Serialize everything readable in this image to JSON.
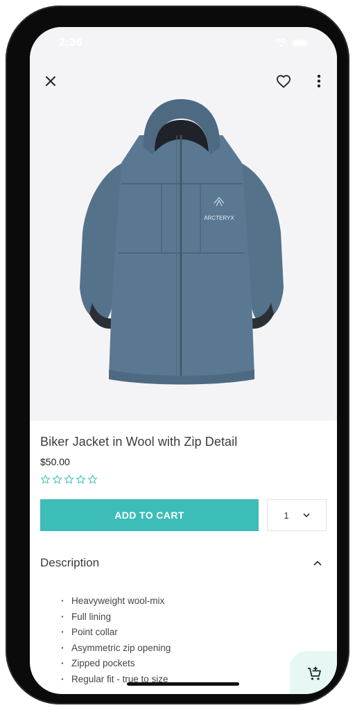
{
  "status_bar": {
    "time": "2:36"
  },
  "icons": {
    "close": "close-icon",
    "favorite": "heart-outline-icon",
    "more": "more-vertical-icon",
    "chevron_up": "chevron-up-icon",
    "chevron_down": "chevron-down-icon",
    "cart_add": "cart-add-icon",
    "star": "star-outline-icon"
  },
  "product": {
    "brand_logo_text": "ARCTERYX",
    "title": "Biker Jacket in Wool with Zip Detail",
    "price": "$50.00",
    "rating": 0,
    "rating_max": 5
  },
  "actions": {
    "add_to_cart_label": "ADD TO CART",
    "quantity_value": "1"
  },
  "description": {
    "heading": "Description",
    "expanded": true,
    "items": [
      "Heavyweight wool-mix",
      "Full lining",
      "Point collar",
      "Asymmetric zip opening",
      "Zipped pockets",
      "Regular fit - true to size"
    ]
  },
  "colors": {
    "accent": "#3dbdb8",
    "hero_background": "#f4f4f7",
    "fab_background": "#e6f7f6",
    "jacket": "#5a7891"
  }
}
